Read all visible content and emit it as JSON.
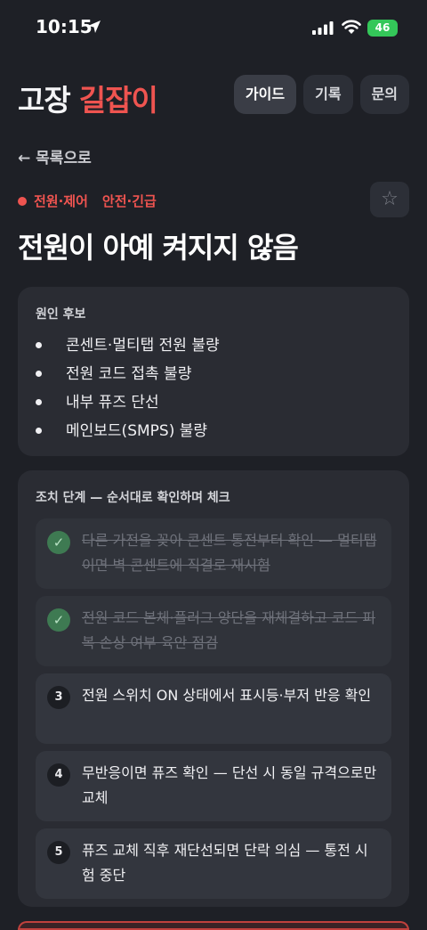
{
  "status_bar": {
    "time": "10:15",
    "battery": "46",
    "icons": [
      "location-arrow-icon",
      "signal-icon",
      "wifi-icon",
      "battery-icon"
    ]
  },
  "header": {
    "title_part1": "고장",
    "title_part2": "길잡이",
    "accent_color": "#ef5450",
    "tabs": [
      {
        "label": "가이드",
        "active": true
      },
      {
        "label": "기록",
        "active": false
      },
      {
        "label": "문의",
        "active": false
      }
    ]
  },
  "back_link": "← 목록으로",
  "issue": {
    "category": "전원·제어",
    "severity": "안전·긴급",
    "title": "전원이 아예 켜지지 않음",
    "favorite_icon": "☆"
  },
  "causes": {
    "label": "원인 후보",
    "items": [
      "콘센트·멀티탭 전원 불량",
      "전원 코드 접촉 불량",
      "내부 퓨즈 단선",
      "메인보드(SMPS) 불량"
    ]
  },
  "steps": {
    "label": "조치 단계 — 순서대로 확인하며 체크",
    "items": [
      {
        "done": true,
        "marker": "✓",
        "text": "다른 가전을 꽂아 콘센트 통전부터 확인 — 멀티탭이면 벽 콘센트에 직결로 재시험"
      },
      {
        "done": true,
        "marker": "✓",
        "text": "전원 코드 본체·플러그 양단을 재체결하고 코드 피복 손상 여부 육안 점검"
      },
      {
        "done": false,
        "marker": "3",
        "text": "전원 스위치 ON 상태에서 표시등·부저 반응 확인"
      },
      {
        "done": false,
        "marker": "4",
        "text": "무반응이면 퓨즈 확인 — 단선 시 동일 규격으로만 교체"
      },
      {
        "done": false,
        "marker": "5",
        "text": "퓨즈 교체 직후 재단선되면 단락 의심 — 통전 시험 중단"
      }
    ]
  }
}
